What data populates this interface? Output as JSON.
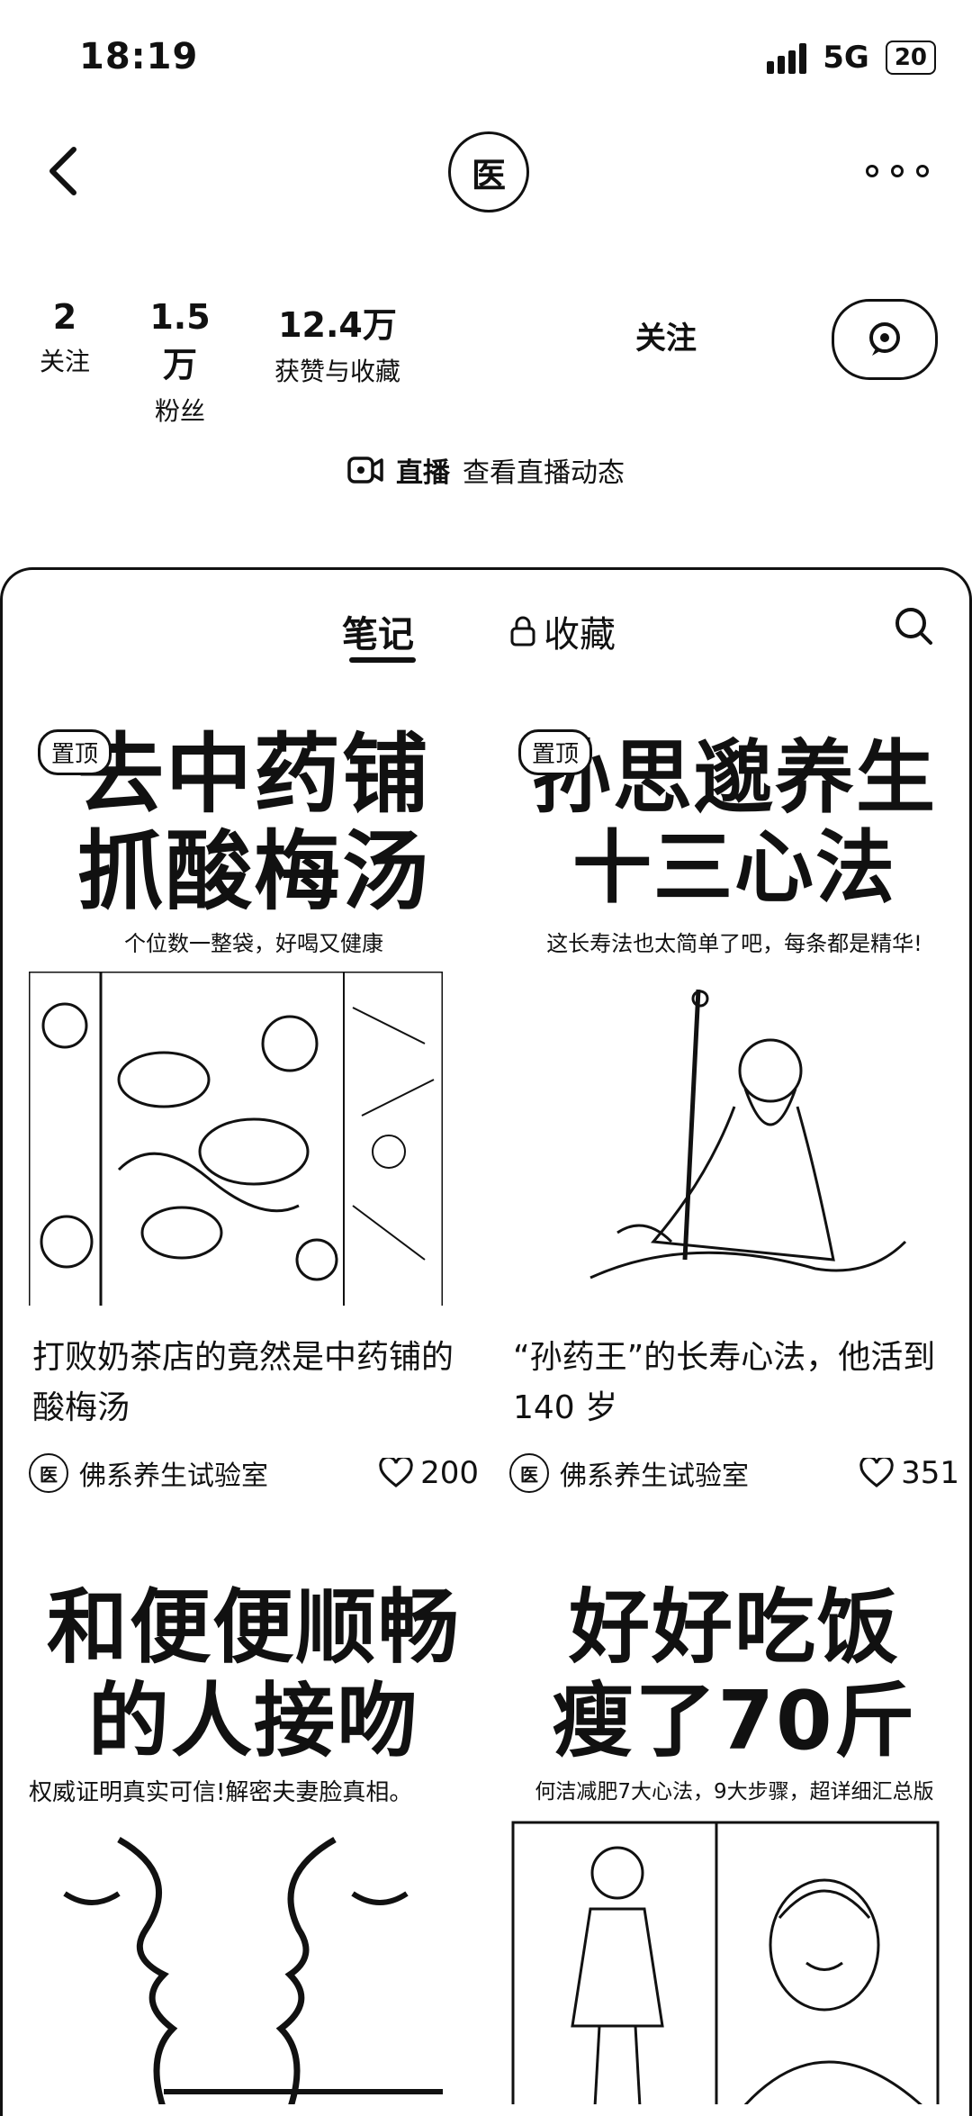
{
  "status_bar": {
    "time": "18:19",
    "network": "5G",
    "battery": "20"
  },
  "profile": {
    "avatar_text": "医"
  },
  "stats": [
    {
      "value": "2",
      "label": "关注"
    },
    {
      "value": "1.5万",
      "label": "粉丝"
    },
    {
      "value": "12.4万",
      "label": "获赞与收藏"
    }
  ],
  "actions": {
    "follow_label": "关注"
  },
  "live": {
    "label": "直播",
    "link": "查看直播动态"
  },
  "tabs": [
    {
      "label": "笔记"
    },
    {
      "label": "收藏"
    }
  ],
  "notes": [
    {
      "pin": "置顶",
      "cover_title_1": "去中药铺",
      "cover_title_2": "抓酸梅汤",
      "cover_sub": "个位数一整袋，好喝又健康",
      "title": "打败奶茶店的竟然是中药铺的酸梅汤",
      "author": "佛系养生试验室",
      "likes": "200"
    },
    {
      "pin": "置顶",
      "cover_title_1": "孙思邈养生",
      "cover_title_2": "十三心法",
      "cover_sub": "这长寿法也太简单了吧，每条都是精华!",
      "title": "“孙药王”的长寿心法，他活到140 岁",
      "author": "佛系养生试验室",
      "likes": "351"
    },
    {
      "cover_title_1": "和便便顺畅",
      "cover_title_2": "的人接吻",
      "cover_sub": "权威证明真实可信!解密夫妻脸真相。"
    },
    {
      "cover_title_1": "好好吃饭",
      "cover_title_2": "瘦了70斤",
      "cover_sub": "何洁减肥7大心法，9大步骤，超详细汇总版"
    }
  ]
}
